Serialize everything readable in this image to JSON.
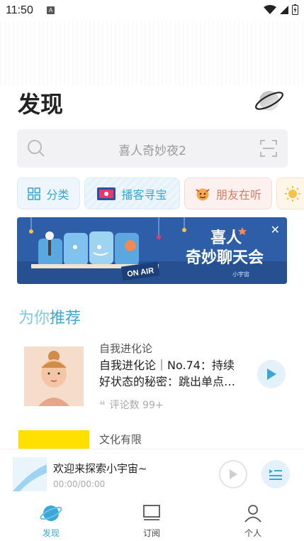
{
  "status": {
    "time": "11:50",
    "badge": "A"
  },
  "page": {
    "title": "发现"
  },
  "search": {
    "placeholder": "喜人奇妙夜2"
  },
  "chips": [
    {
      "label": "分类",
      "icon": "grid-icon"
    },
    {
      "label": "播客寻宝",
      "icon": "treasure-icon"
    },
    {
      "label": "朋友在听",
      "icon": "face-icon"
    },
    {
      "label": "",
      "icon": "sun-icon"
    }
  ],
  "banner": {
    "line1": "喜人",
    "line2": "奇妙聊天会",
    "tag": "ON AIR",
    "brand": "小宇宙"
  },
  "section": {
    "title_a": "为你",
    "title_b": "推荐"
  },
  "items": [
    {
      "category": "自我进化论",
      "title": "自我进化论｜No.74：持续好状态的秘密：跳出单点…",
      "comments": "评论数 99+"
    },
    {
      "category": "文化有限"
    }
  ],
  "player": {
    "title": "欢迎来探索小宇宙~",
    "time": "00:00/00:00"
  },
  "tabs": [
    {
      "label": "发现"
    },
    {
      "label": "订阅"
    },
    {
      "label": "个人"
    }
  ],
  "colors": {
    "accent": "#3aa7d6",
    "accent_light": "#e3f1fa"
  }
}
